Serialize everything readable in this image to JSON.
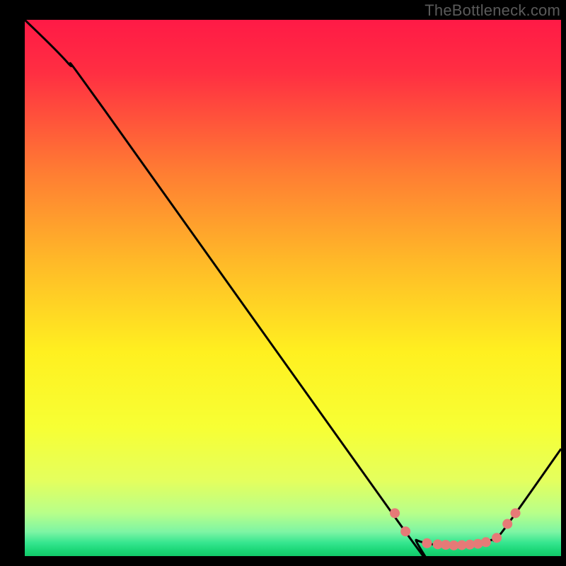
{
  "watermark": "TheBottleneck.com",
  "chart_data": {
    "type": "line",
    "title": "",
    "xlabel": "",
    "ylabel": "",
    "xlim": [
      0,
      100
    ],
    "ylim": [
      0,
      100
    ],
    "curve": {
      "name": "bottleneck-curve",
      "points": [
        {
          "x": 0,
          "y": 100
        },
        {
          "x": 8,
          "y": 92
        },
        {
          "x": 15,
          "y": 83
        },
        {
          "x": 71,
          "y": 4.5
        },
        {
          "x": 73,
          "y": 3.0
        },
        {
          "x": 76,
          "y": 2.2
        },
        {
          "x": 80,
          "y": 2.0
        },
        {
          "x": 84,
          "y": 2.2
        },
        {
          "x": 87,
          "y": 3.0
        },
        {
          "x": 89,
          "y": 4.5
        },
        {
          "x": 100,
          "y": 20
        }
      ]
    },
    "markers": {
      "name": "highlighted-points",
      "color": "#e67a77",
      "radius": 7,
      "points": [
        {
          "x": 69,
          "y": 8.0
        },
        {
          "x": 71,
          "y": 4.6
        },
        {
          "x": 75,
          "y": 2.4
        },
        {
          "x": 77,
          "y": 2.2
        },
        {
          "x": 78.5,
          "y": 2.1
        },
        {
          "x": 80,
          "y": 2.0
        },
        {
          "x": 81.5,
          "y": 2.05
        },
        {
          "x": 83,
          "y": 2.15
        },
        {
          "x": 84.5,
          "y": 2.3
        },
        {
          "x": 86,
          "y": 2.6
        },
        {
          "x": 88,
          "y": 3.4
        },
        {
          "x": 90,
          "y": 6.0
        },
        {
          "x": 91.5,
          "y": 8.0
        }
      ]
    },
    "gradient_stops": [
      {
        "offset": 0.0,
        "color": "#ff1a46"
      },
      {
        "offset": 0.1,
        "color": "#ff2f42"
      },
      {
        "offset": 0.28,
        "color": "#ff7b33"
      },
      {
        "offset": 0.45,
        "color": "#ffb928"
      },
      {
        "offset": 0.62,
        "color": "#fff020"
      },
      {
        "offset": 0.76,
        "color": "#f7ff34"
      },
      {
        "offset": 0.86,
        "color": "#e4ff5e"
      },
      {
        "offset": 0.92,
        "color": "#b7ff8a"
      },
      {
        "offset": 0.955,
        "color": "#7df5a4"
      },
      {
        "offset": 0.975,
        "color": "#36e68f"
      },
      {
        "offset": 0.99,
        "color": "#1ad676"
      },
      {
        "offset": 1.0,
        "color": "#12c96a"
      }
    ]
  }
}
